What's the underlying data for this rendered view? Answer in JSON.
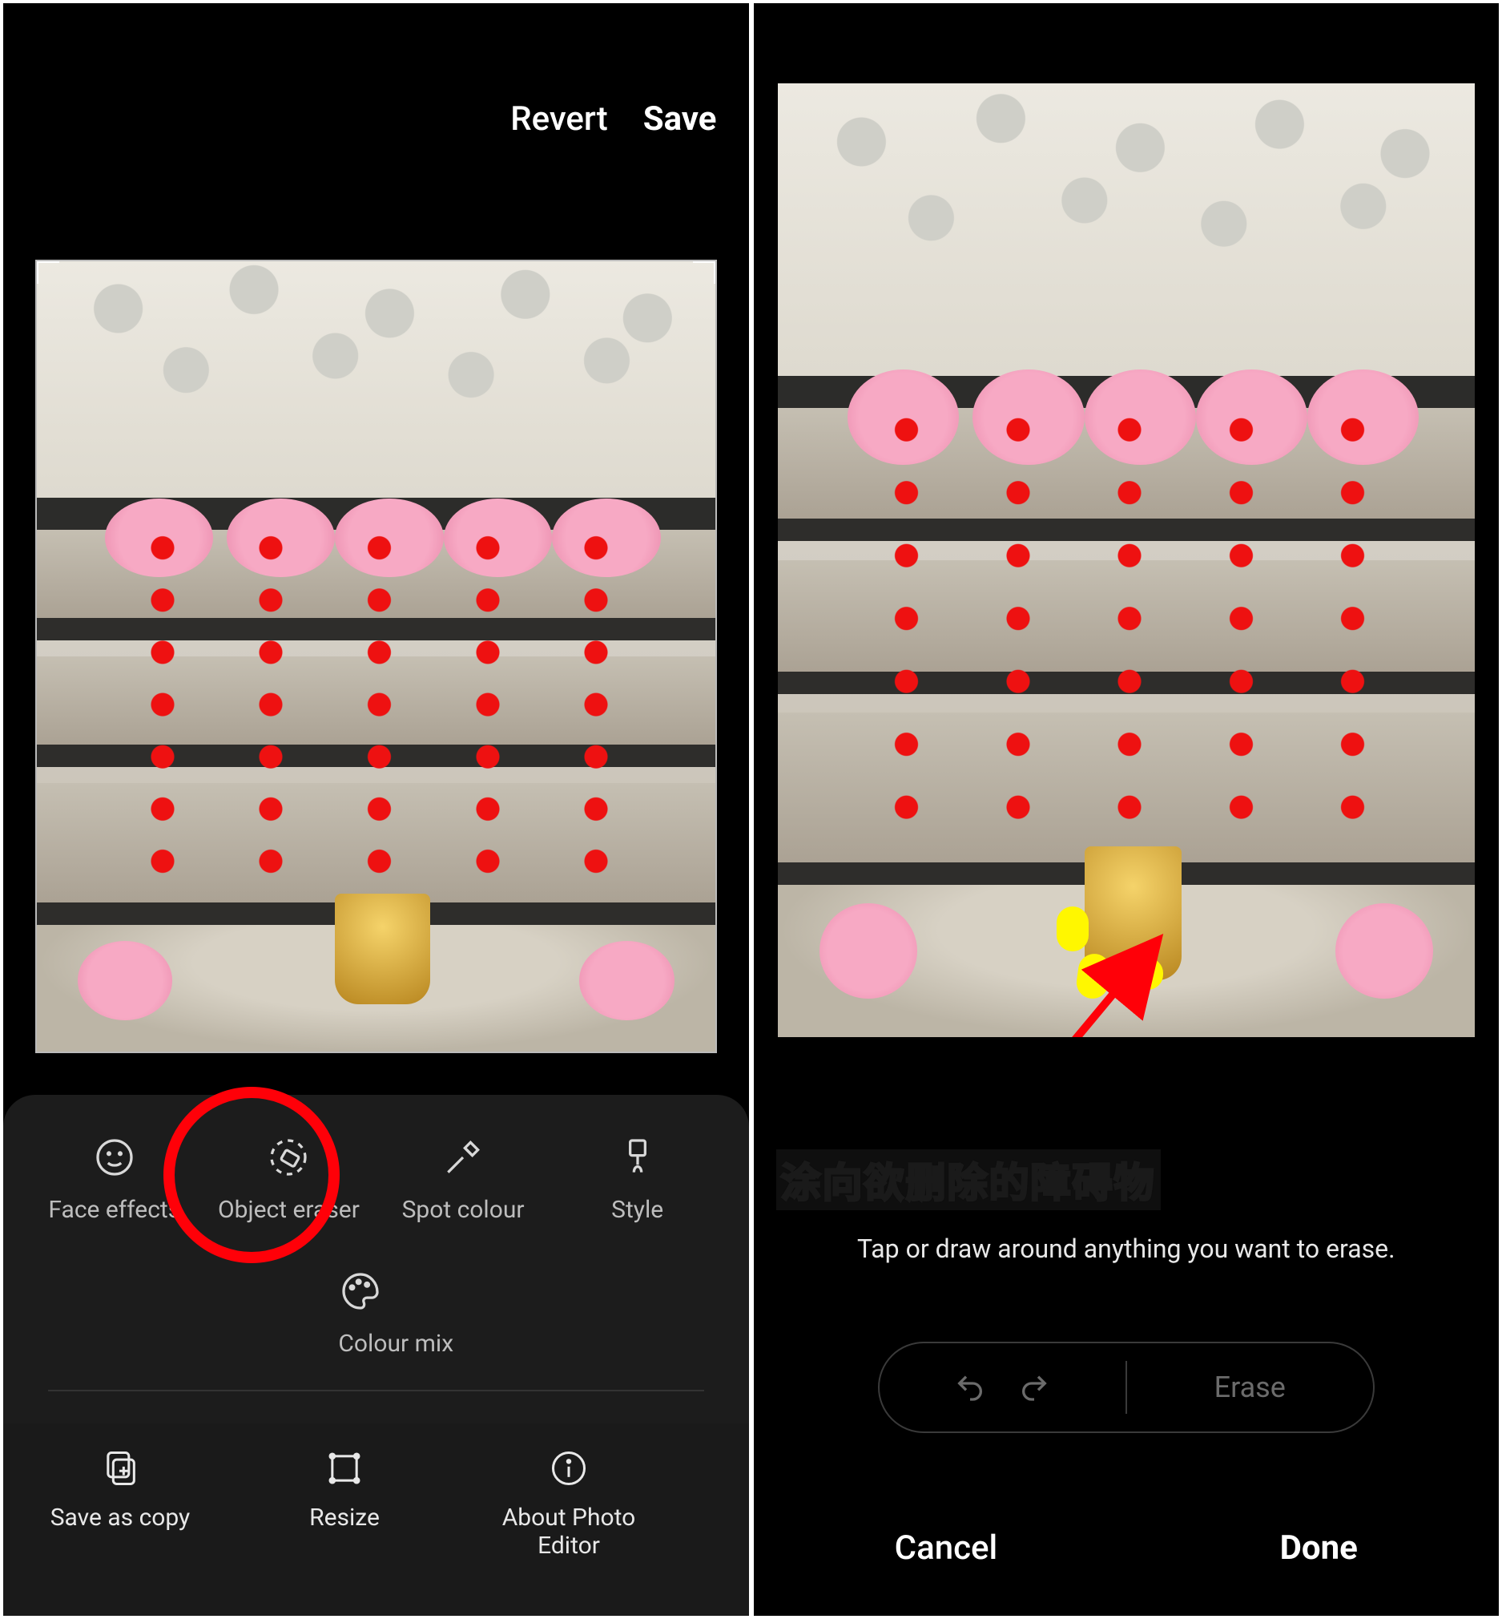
{
  "left": {
    "top_actions": {
      "revert": "Revert",
      "save": "Save"
    },
    "tools_row1": [
      {
        "id": "face-effects",
        "label": "Face effects"
      },
      {
        "id": "object-eraser",
        "label": "Object eraser"
      },
      {
        "id": "spot-colour",
        "label": "Spot colour"
      },
      {
        "id": "style",
        "label": "Style"
      }
    ],
    "tools_row2": [
      {
        "id": "colour-mix",
        "label": "Colour mix"
      }
    ],
    "bottom_bar": [
      {
        "id": "save-as-copy",
        "label": "Save as copy"
      },
      {
        "id": "resize",
        "label": "Resize"
      },
      {
        "id": "about",
        "label": "About Photo Editor"
      }
    ]
  },
  "right": {
    "annotation_text": "涂向欲删除的障碍物",
    "hint": "Tap or draw around anything you want to erase.",
    "erase_label": "Erase",
    "bottom_actions": {
      "cancel": "Cancel",
      "done": "Done"
    }
  }
}
